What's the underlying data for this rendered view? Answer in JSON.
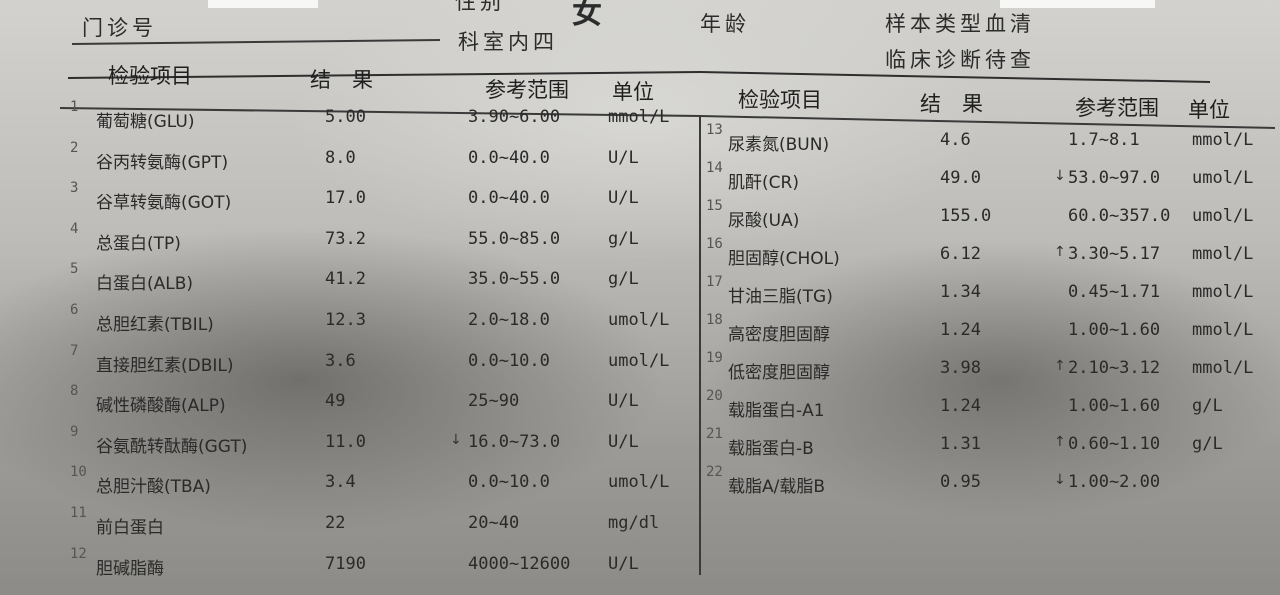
{
  "header": {
    "clinic_no_label": "门诊号",
    "sex_label": "性别",
    "sex_value": "女",
    "age_label": "年龄",
    "sample_label": "样本类型",
    "sample_value": "血清",
    "dept_label": "科室",
    "dept_value": "内四",
    "diag_label": "临床诊断",
    "diag_value": "待查"
  },
  "columns": {
    "item": "检验项目",
    "result": "结　果",
    "range": "参考范围",
    "unit": "单位"
  },
  "left_rows": [
    {
      "no": "1",
      "name": "葡萄糖(GLU)",
      "result": "5.00",
      "flag": "",
      "range": "3.90~6.00",
      "unit": "mmol/L"
    },
    {
      "no": "2",
      "name": "谷丙转氨酶(GPT)",
      "result": "8.0",
      "flag": "",
      "range": "0.0~40.0",
      "unit": "U/L"
    },
    {
      "no": "3",
      "name": "谷草转氨酶(GOT)",
      "result": "17.0",
      "flag": "",
      "range": "0.0~40.0",
      "unit": "U/L"
    },
    {
      "no": "4",
      "name": "总蛋白(TP)",
      "result": "73.2",
      "flag": "",
      "range": "55.0~85.0",
      "unit": "g/L"
    },
    {
      "no": "5",
      "name": "白蛋白(ALB)",
      "result": "41.2",
      "flag": "",
      "range": "35.0~55.0",
      "unit": "g/L"
    },
    {
      "no": "6",
      "name": "总胆红素(TBIL)",
      "result": "12.3",
      "flag": "",
      "range": "2.0~18.0",
      "unit": "umol/L"
    },
    {
      "no": "7",
      "name": "直接胆红素(DBIL)",
      "result": "3.6",
      "flag": "",
      "range": "0.0~10.0",
      "unit": "umol/L"
    },
    {
      "no": "8",
      "name": "碱性磷酸酶(ALP)",
      "result": "49",
      "flag": "",
      "range": "25~90",
      "unit": "U/L"
    },
    {
      "no": "9",
      "name": "谷氨酰转酞酶(GGT)",
      "result": "11.0",
      "flag": "↓",
      "range": "16.0~73.0",
      "unit": "U/L"
    },
    {
      "no": "10",
      "name": "总胆汁酸(TBA)",
      "result": "3.4",
      "flag": "",
      "range": "0.0~10.0",
      "unit": "umol/L"
    },
    {
      "no": "11",
      "name": "前白蛋白",
      "result": "22",
      "flag": "",
      "range": "20~40",
      "unit": "mg/dl"
    },
    {
      "no": "12",
      "name": "胆碱脂酶",
      "result": "7190",
      "flag": "",
      "range": "4000~12600",
      "unit": "U/L"
    }
  ],
  "right_rows": [
    {
      "no": "13",
      "name": "尿素氮(BUN)",
      "result": "4.6",
      "flag": "",
      "range": "1.7~8.1",
      "unit": "mmol/L"
    },
    {
      "no": "14",
      "name": "肌酐(CR)",
      "result": "49.0",
      "flag": "↓",
      "range": "53.0~97.0",
      "unit": "umol/L"
    },
    {
      "no": "15",
      "name": "尿酸(UA)",
      "result": "155.0",
      "flag": "",
      "range": "60.0~357.0",
      "unit": "umol/L"
    },
    {
      "no": "16",
      "name": "胆固醇(CHOL)",
      "result": "6.12",
      "flag": "↑",
      "range": "3.30~5.17",
      "unit": "mmol/L"
    },
    {
      "no": "17",
      "name": "甘油三脂(TG)",
      "result": "1.34",
      "flag": "",
      "range": "0.45~1.71",
      "unit": "mmol/L"
    },
    {
      "no": "18",
      "name": "高密度胆固醇",
      "result": "1.24",
      "flag": "",
      "range": "1.00~1.60",
      "unit": "mmol/L"
    },
    {
      "no": "19",
      "name": "低密度胆固醇",
      "result": "3.98",
      "flag": "↑",
      "range": "2.10~3.12",
      "unit": "mmol/L"
    },
    {
      "no": "20",
      "name": "载脂蛋白-A1",
      "result": "1.24",
      "flag": "",
      "range": "1.00~1.60",
      "unit": "g/L"
    },
    {
      "no": "21",
      "name": "载脂蛋白-B",
      "result": "1.31",
      "flag": "↑",
      "range": "0.60~1.10",
      "unit": "g/L"
    },
    {
      "no": "22",
      "name": "载脂A/载脂B",
      "result": "0.95",
      "flag": "↓",
      "range": "1.00~2.00",
      "unit": ""
    }
  ]
}
